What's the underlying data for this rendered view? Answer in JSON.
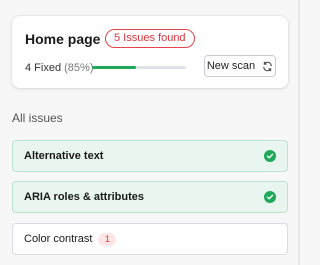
{
  "summary": {
    "page_title": "Home page",
    "issues_badge": "5 Issues found",
    "fixed_label": "4 Fixed",
    "fixed_percent": "(85%)",
    "progress_fraction": 0.47,
    "new_scan_label": "New scan",
    "new_scan_icon": "refresh-icon"
  },
  "issues_section": {
    "heading": "All issues",
    "items": [
      {
        "label": "Alternative text",
        "status": "fixed",
        "icon": "check-circle-icon"
      },
      {
        "label": "ARIA roles & attributes",
        "status": "fixed",
        "icon": "check-circle-icon"
      },
      {
        "label": "Color contrast",
        "status": "open",
        "count": "1"
      }
    ]
  },
  "colors": {
    "accent_green": "#1fa85a",
    "fixed_row_bg": "#e8f6ef",
    "issue_red": "#d9363e",
    "count_badge_bg": "#fde6e6"
  }
}
